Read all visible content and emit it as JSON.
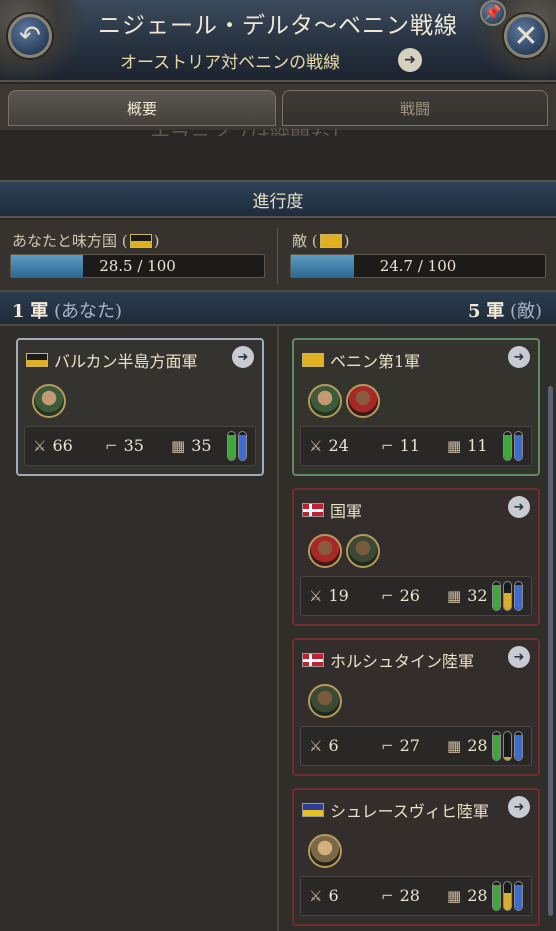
{
  "header": {
    "title": "ニジェール・デルタ〜ベニン戦線",
    "subtitle": "オーストリア対ベニンの戦線",
    "back_icon": "back-arrow-icon",
    "close_icon": "close-icon",
    "pin_icon": "pin-icon"
  },
  "tabs": [
    {
      "label": "概要",
      "active": true
    },
    {
      "label": "戦闘",
      "active": false
    }
  ],
  "ghost_text": "ナファイノは戦闘なし",
  "progress": {
    "title": "進行度",
    "left_label": "あなたと味方国 (",
    "left_label_end": ")",
    "right_label": "敵 (",
    "right_label_end": ")",
    "left_value": 28.5,
    "left_text": "28.5 / 100",
    "right_value": 24.7,
    "right_text": "24.7 / 100",
    "max": 100
  },
  "armies": {
    "left_count": "1",
    "left_word": "軍",
    "left_owner": "(あなた)",
    "right_count": "5",
    "right_word": "軍",
    "right_owner": "(敵)"
  },
  "left_cards": [
    {
      "name": "バルカン半島方面軍",
      "flag": "austria",
      "portraits": 1,
      "manpower": "66",
      "arms": "35",
      "supplies": "35",
      "pills": [
        0.9,
        0.9
      ]
    }
  ],
  "right_cards": [
    {
      "name": "ベニン第1軍",
      "flag": "benin",
      "portraits": 2,
      "manpower": "24",
      "arms": "11",
      "supplies": "11",
      "pills": [
        0.9,
        0.9
      ]
    },
    {
      "name": "国軍",
      "flag": "denmark",
      "portraits": 2,
      "manpower": "19",
      "arms": "26",
      "supplies": "32",
      "pills": [
        0.9,
        0.6,
        0.9
      ]
    },
    {
      "name": "ホルシュタイン陸軍",
      "flag": "denmark",
      "portraits": 1,
      "manpower": "6",
      "arms": "27",
      "supplies": "28",
      "pills": [
        0.9,
        0.1,
        0.9
      ]
    },
    {
      "name": "シュレースヴィヒ陸軍",
      "flag": "sleswig",
      "portraits": 1,
      "manpower": "6",
      "arms": "28",
      "supplies": "28",
      "pills": [
        0.9,
        0.6,
        0.9
      ]
    }
  ],
  "colors": {
    "bar_fill": "#3f84b0",
    "card_mine_border": "#a2abba",
    "card_ally_border": "#5f8a65",
    "card_enemy_border": "#6e2e2e"
  }
}
